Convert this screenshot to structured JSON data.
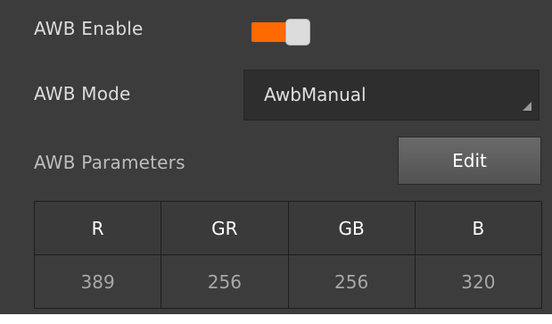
{
  "awb": {
    "enable_label": "AWB Enable",
    "enabled": true,
    "mode_label": "AWB Mode",
    "mode_value": "AwbManual",
    "params_label": "AWB Parameters",
    "edit_label": "Edit"
  },
  "table": {
    "headers": [
      "R",
      "GR",
      "GB",
      "B"
    ],
    "values": [
      "389",
      "256",
      "256",
      "320"
    ]
  },
  "colors": {
    "panel_bg": "#3c3c3c",
    "toggle_on": "#ff6a00",
    "dropdown_bg": "#2e2e2e"
  },
  "icons": {
    "dropdown_corner": "dropdown-corner-icon"
  }
}
